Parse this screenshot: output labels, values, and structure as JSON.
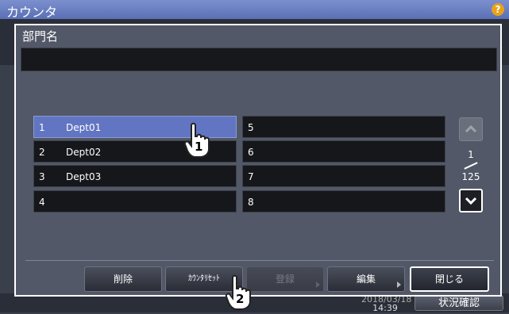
{
  "screen": {
    "title": "カウンタ",
    "help": "?"
  },
  "dialog": {
    "title": "部門名",
    "name_value": ""
  },
  "list": {
    "rows": [
      {
        "num": "1",
        "name": "Dept01",
        "selected": true
      },
      {
        "num": "2",
        "name": "Dept02"
      },
      {
        "num": "3",
        "name": "Dept03"
      },
      {
        "num": "4",
        "name": ""
      },
      {
        "num": "5",
        "name": ""
      },
      {
        "num": "6",
        "name": ""
      },
      {
        "num": "7",
        "name": ""
      },
      {
        "num": "8",
        "name": ""
      }
    ]
  },
  "pager": {
    "current": "1",
    "total": "125"
  },
  "buttons": {
    "delete": "削除",
    "counter_reset": "ｶｳﾝﾀﾘｾｯﾄ",
    "register": "登録",
    "edit": "編集",
    "close": "閉じる"
  },
  "status": {
    "clock_time": "14:39",
    "status_check": "状況確認"
  },
  "callouts": [
    "1",
    "2"
  ],
  "colors": {
    "selected_row": "#6275c2",
    "titlebar": "#7c90cf",
    "accent_help": "#e8a21a"
  }
}
